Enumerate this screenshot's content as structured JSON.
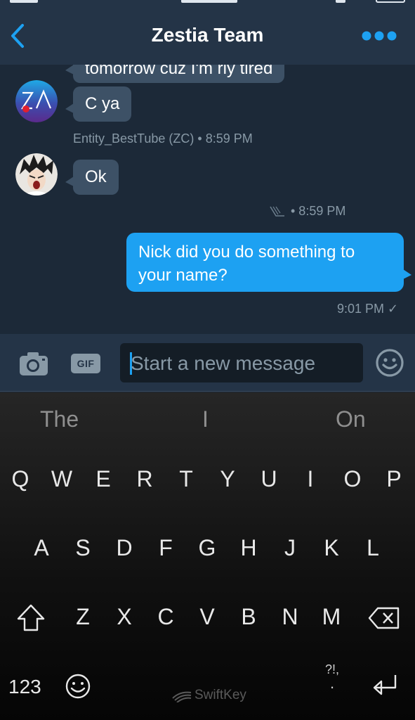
{
  "header": {
    "title": "Zestia Team",
    "back_icon": "chevron-left-icon",
    "more_icon": "more-dots-icon",
    "accent": "#1da1f2"
  },
  "messages": {
    "partial_text": "tomorrow cuz I'm rly tired",
    "m1_text": "C ya",
    "m1_meta": "Entity_BestTube (ZC) • 8:59 PM",
    "m2_text": "Ok",
    "m2_time": "• 8:59 PM",
    "m3_text": "Nick did you do something to your name?",
    "m3_time": "9:01 PM ✓"
  },
  "composer": {
    "placeholder": "Start a new message",
    "gif_label": "GIF",
    "camera_icon": "camera-icon",
    "emoji_icon": "smiley-icon"
  },
  "keyboard": {
    "suggestions": [
      "The",
      "I",
      "On"
    ],
    "row1": [
      "Q",
      "W",
      "E",
      "R",
      "T",
      "Y",
      "U",
      "I",
      "O",
      "P"
    ],
    "row2": [
      "A",
      "S",
      "D",
      "F",
      "G",
      "H",
      "J",
      "K",
      "L"
    ],
    "row3": [
      "Z",
      "X",
      "C",
      "V",
      "B",
      "N",
      "M"
    ],
    "num_label": "123",
    "punct_top": "?!,",
    "punct_bottom": ".",
    "brand": "SwiftKey"
  }
}
